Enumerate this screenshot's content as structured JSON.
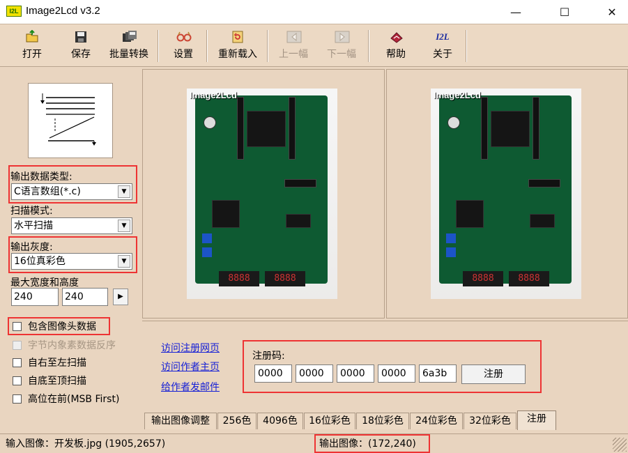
{
  "window": {
    "icon_text": "I2L",
    "title": "Image2Lcd v3.2",
    "minimize_glyph": "—",
    "maximize_glyph": "☐",
    "close_glyph": "✕"
  },
  "toolbar": {
    "buttons": [
      {
        "label": "打开",
        "icon": "open-folder-icon",
        "enabled": true
      },
      {
        "label": "保存",
        "icon": "save-disk-icon",
        "enabled": true
      },
      {
        "label": "批量转换",
        "icon": "batch-convert-icon",
        "enabled": true
      },
      {
        "label": "设置",
        "icon": "settings-glasses-icon",
        "enabled": true
      },
      {
        "label": "重新载入",
        "icon": "reload-icon",
        "enabled": true
      },
      {
        "label": "上一幅",
        "icon": "previous-arrow-icon",
        "enabled": false
      },
      {
        "label": "下一幅",
        "icon": "next-arrow-icon",
        "enabled": false
      },
      {
        "label": "帮助",
        "icon": "help-book-icon",
        "enabled": true
      },
      {
        "label": "关于",
        "icon": "about-i2l-icon",
        "enabled": true
      }
    ],
    "about_icon_text": "I2L"
  },
  "settings": {
    "output_type_label": "输出数据类型:",
    "output_type_value": "C语言数组(*.c)",
    "scan_mode_label": "扫描模式:",
    "scan_mode_value": "水平扫描",
    "gray_label": "输出灰度:",
    "gray_value": "16位真彩色",
    "size_label": "最大宽度和高度",
    "max_width": "240",
    "max_height": "240",
    "apply_glyph": "▶",
    "checkboxes": [
      {
        "label": "包含图像头数据",
        "checked": false,
        "enabled": true
      },
      {
        "label": "字节内象素数据反序",
        "checked": false,
        "enabled": false
      },
      {
        "label": "自右至左扫描",
        "checked": false,
        "enabled": true
      },
      {
        "label": "自底至顶扫描",
        "checked": false,
        "enabled": true
      },
      {
        "label": "高位在前(MSB First)",
        "checked": false,
        "enabled": true
      }
    ]
  },
  "preview": {
    "input_overlay": "Image2Lcd",
    "output_overlay": "Image2Lcd",
    "display_digits": "8888"
  },
  "register": {
    "links": [
      "访问注册网页",
      "访问作者主页",
      "给作者发邮件"
    ],
    "code_label": "注册码:",
    "codes": [
      "0000",
      "0000",
      "0000",
      "0000",
      "6a3b"
    ],
    "register_button": "注册"
  },
  "tabs": [
    {
      "label": "输出图像调整",
      "active": false
    },
    {
      "label": "256色",
      "active": false
    },
    {
      "label": "4096色",
      "active": false
    },
    {
      "label": "16位彩色",
      "active": false
    },
    {
      "label": "18位彩色",
      "active": false
    },
    {
      "label": "24位彩色",
      "active": false
    },
    {
      "label": "32位彩色",
      "active": false
    },
    {
      "label": "注册",
      "active": true
    }
  ],
  "status": {
    "input_image": "输入图像：开发板.jpg (1905,2657)",
    "output_image": "输出图像：(172,240)"
  },
  "colors": {
    "background": "#e9d5c0",
    "highlight_box": "#e33333",
    "link": "#1620d6",
    "pcb_green": "#0e5a32"
  }
}
